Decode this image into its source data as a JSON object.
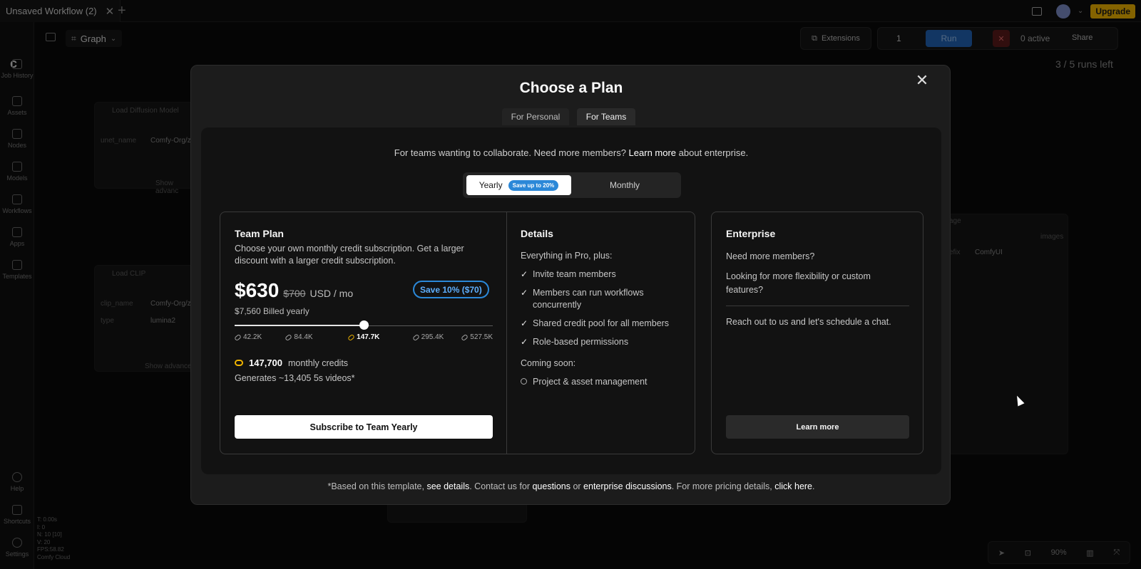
{
  "window": {
    "tab_title": "Unsaved Workflow (2)",
    "close_glyph": "✕",
    "new_tab_glyph": "+",
    "upgrade_label": "Upgrade",
    "caret_glyph": "⌄"
  },
  "sidebar": {
    "items": [
      {
        "label": "Job History",
        "icon": "history-icon"
      },
      {
        "label": "Assets",
        "icon": "image-icon"
      },
      {
        "label": "Nodes",
        "icon": "nodes-icon"
      },
      {
        "label": "Models",
        "icon": "models-icon"
      },
      {
        "label": "Workflows",
        "icon": "workflow-icon"
      },
      {
        "label": "Apps",
        "icon": "apps-icon"
      },
      {
        "label": "Templates",
        "icon": "templates-icon"
      },
      {
        "label": "Help",
        "icon": "help-icon"
      },
      {
        "label": "Shortcuts",
        "icon": "keyboard-icon"
      },
      {
        "label": "Settings",
        "icon": "gear-icon"
      }
    ]
  },
  "canvas": {
    "graph_label": "Graph",
    "extensions_label": "Extensions",
    "run_count": "1",
    "run_label": "Run",
    "active_label": "0 active",
    "share_label": "Share",
    "runs_left": "3 / 5 runs left",
    "zoom": "90%",
    "node_load_diffusion": "Load Diffusion Model",
    "node_unet_label": "unet_name",
    "node_unet_value": "Comfy-Org/z",
    "node_show_advanced": "Show advanc",
    "node_load_clip": "Load CLIP",
    "node_clip_label": "clip_name",
    "node_clip_value": "Comfy-Org/z",
    "node_type_label": "type",
    "node_type_value": "lumina2",
    "node_show_advanced_2": "Show advance",
    "node_right_images": "images",
    "node_right_prefix": "efix",
    "node_right_value": "ComfyUI",
    "node_right_title": "age",
    "stats": [
      "T: 0.00s",
      "I: 0",
      "N: 10 [10]",
      "V: 20",
      "FPS:58.82",
      "Comfy Cloud"
    ]
  },
  "modal": {
    "title": "Choose a Plan",
    "close_glyph": "✕",
    "tabs": {
      "personal": "For Personal",
      "teams": "For Teams"
    },
    "intro_before": "For teams wanting to collaborate. Need more members? ",
    "intro_link": "Learn more",
    "intro_after": " about enterprise.",
    "billing": {
      "yearly": "Yearly",
      "save_pill": "Save up to 20%",
      "monthly": "Monthly"
    },
    "team_plan": {
      "title": "Team Plan",
      "description": "Choose your own monthly credit subscription. Get a larger discount with a larger credit subscription.",
      "price": "$630",
      "old_price": "$700",
      "unit": "USD / mo",
      "save_badge": "Save 10% ($70)",
      "billed": "$7,560 Billed yearly",
      "slider_ticks": [
        "42.2K",
        "84.4K",
        "147.7K",
        "295.4K",
        "527.5K"
      ],
      "slider_value_index": 2,
      "credits_value": "147,700",
      "credits_label": "monthly credits",
      "generates": "Generates ~13,405 5s videos*",
      "subscribe_label": "Subscribe to Team Yearly"
    },
    "details": {
      "title": "Details",
      "intro": "Everything in Pro, plus:",
      "check_glyph": "✓",
      "features": [
        "Invite team members",
        "Members can run workflows concurrently",
        "Shared credit pool for all members",
        "Role-based permissions"
      ],
      "coming_soon_label": "Coming soon:",
      "coming_soon": [
        "Project & asset management"
      ]
    },
    "enterprise": {
      "title": "Enterprise",
      "line1": "Need more members?",
      "line2": "Looking for more flexibility or custom features?",
      "line3": "Reach out to us and let's schedule a chat.",
      "button": "Learn more"
    },
    "footnote": {
      "p1": "*Based on this template, ",
      "l1": "see details",
      "p2": ". Contact us for ",
      "l2": "questions",
      "p3": " or ",
      "l3": "enterprise discussions",
      "p4": ". For more pricing details, ",
      "l4": "click here",
      "p5": "."
    }
  },
  "colors": {
    "accent_blue": "#2b88d8",
    "upgrade_yellow": "#f0b400",
    "run_blue": "#2163b5"
  }
}
